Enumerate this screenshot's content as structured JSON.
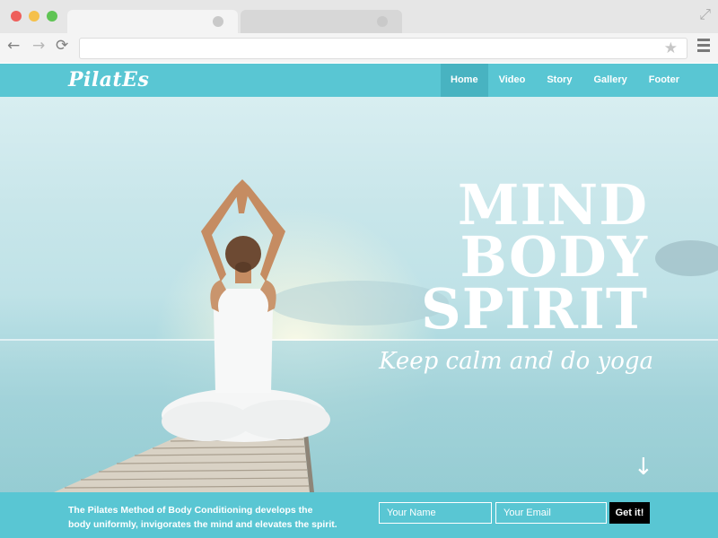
{
  "browser": {
    "icons": {
      "back": "←",
      "forward": "→",
      "reload": "⟳",
      "star": "★",
      "fullscreen": "⤢"
    },
    "window_colors": {
      "close": "#ee5f5b",
      "minimize": "#f5c04a",
      "maximize": "#5fc454"
    }
  },
  "site": {
    "logo": "PilatEs",
    "nav": [
      {
        "label": "Home",
        "active": true
      },
      {
        "label": "Video",
        "active": false
      },
      {
        "label": "Story",
        "active": false
      },
      {
        "label": "Gallery",
        "active": false
      },
      {
        "label": "Footer",
        "active": false
      }
    ],
    "accent_color": "#59c6d3"
  },
  "hero": {
    "headline": [
      "MIND",
      "BODY",
      "SPIRIT"
    ],
    "tagline": "Keep calm and do yoga",
    "scroll_icon": "↓"
  },
  "signup": {
    "blurb": "The Pilates Method of Body Conditioning develops the body uniformly, invigorates the mind and elevates the spirit.",
    "name_placeholder": "Your Name",
    "email_placeholder": "Your Email",
    "submit_label": "Get it!"
  }
}
